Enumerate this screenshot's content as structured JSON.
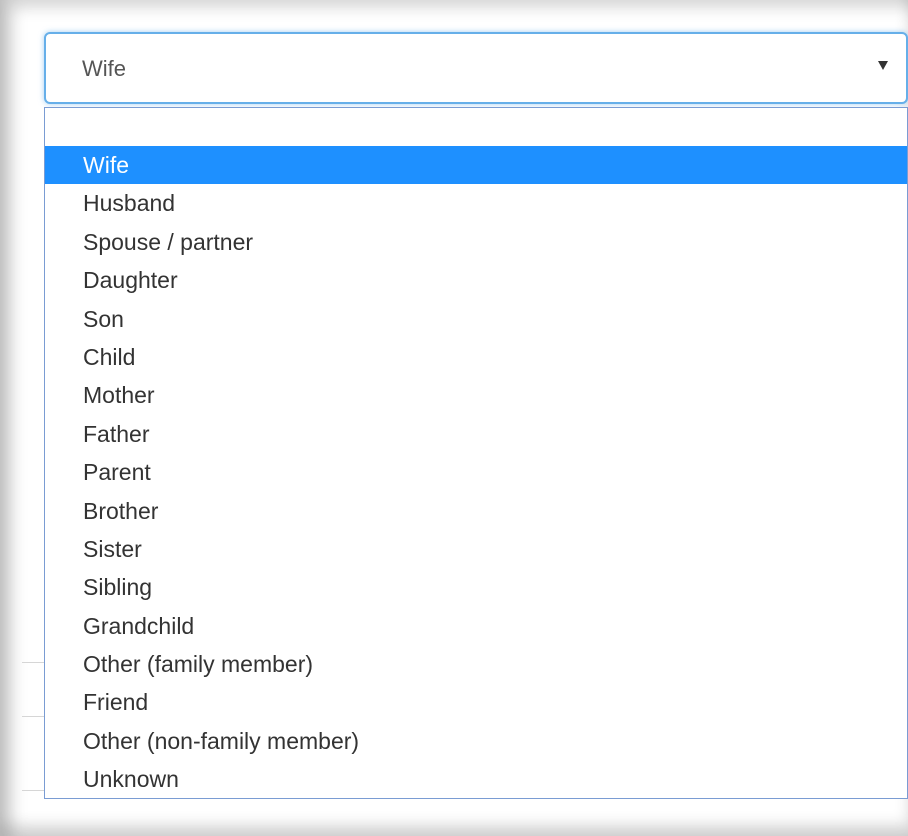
{
  "relationship_select": {
    "value": "Wife",
    "caret_icon": "caret-down-icon",
    "options": [
      "",
      "Wife",
      "Husband",
      "Spouse / partner",
      "Daughter",
      "Son",
      "Child",
      "Mother",
      "Father",
      "Parent",
      "Brother",
      "Sister",
      "Sibling",
      "Grandchild",
      "Other (family member)",
      "Friend",
      "Other (non-family member)",
      "Unknown"
    ],
    "selected_index": 1
  },
  "colors": {
    "highlight": "#1e90ff",
    "focus_border": "#66afe9"
  }
}
